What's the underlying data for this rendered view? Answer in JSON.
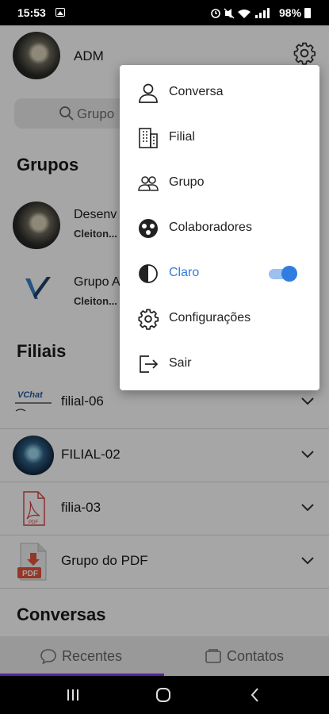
{
  "status_bar": {
    "time": "15:53",
    "battery": "98%",
    "icons": [
      "image-icon",
      "alarm-icon",
      "mute-icon",
      "wifi-icon",
      "signal-icon",
      "battery-icon"
    ]
  },
  "header": {
    "user_name": "ADM"
  },
  "search": {
    "placeholder": "Grupo"
  },
  "sections": {
    "groups": "Grupos",
    "branches": "Filiais",
    "conversations": "Conversas"
  },
  "groups": [
    {
      "name": "Desenv",
      "sub": "Cleiton..."
    },
    {
      "name": "Grupo A",
      "sub": "Cleiton..."
    }
  ],
  "branches": [
    {
      "name": "filial-06",
      "thumb": "vchat-logo"
    },
    {
      "name": "FILIAL-02",
      "thumb": "avatar"
    },
    {
      "name": "filia-03",
      "thumb": "pdf-outline-icon"
    },
    {
      "name": "Grupo do PDF",
      "thumb": "pdf-file-icon"
    }
  ],
  "thumb_text": {
    "vchat": "VChat",
    "pdf": "PDF"
  },
  "bottom_nav": {
    "recent": "Recentes",
    "contacts": "Contatos"
  },
  "menu": [
    {
      "label": "Conversa",
      "icon": "person-icon"
    },
    {
      "label": "Filial",
      "icon": "building-icon"
    },
    {
      "label": "Grupo",
      "icon": "group-icon"
    },
    {
      "label": "Colaboradores",
      "icon": "collaborators-icon"
    },
    {
      "label": "Claro",
      "icon": "theme-contrast-icon",
      "toggle_on": true
    },
    {
      "label": "Configurações",
      "icon": "settings-icon"
    },
    {
      "label": "Sair",
      "icon": "logout-icon"
    }
  ],
  "colors": {
    "accent": "#2f7de1",
    "active_tab": "#7c3aed",
    "scrim": "rgba(0,0,0,0.35)"
  }
}
